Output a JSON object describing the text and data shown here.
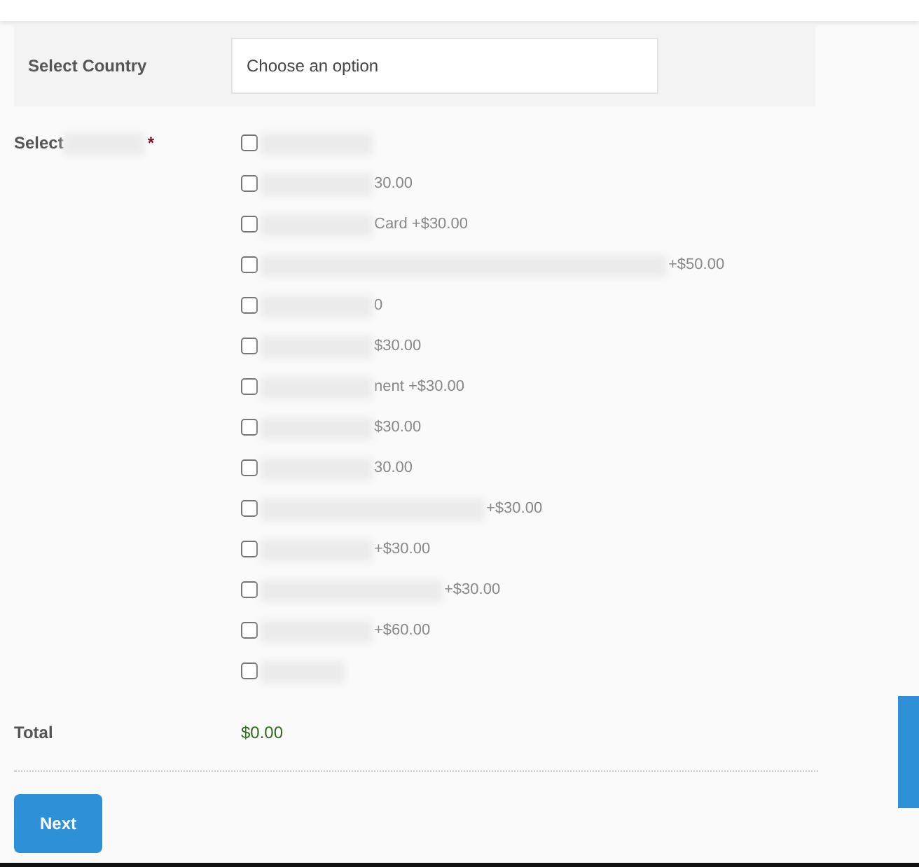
{
  "country": {
    "label": "Select Country",
    "placeholder": "Choose an option"
  },
  "documents": {
    "label": "Select",
    "required_mark": "*",
    "options": [
      {
        "checked": false
      },
      {
        "text": "30.00",
        "checked": false
      },
      {
        "text": "Card +$30.00",
        "checked": false
      },
      {
        "text": "+$50.00",
        "checked": false
      },
      {
        "text": "0",
        "checked": false
      },
      {
        "text": "$30.00",
        "checked": false
      },
      {
        "text": "nent +$30.00",
        "checked": false
      },
      {
        "text": "$30.00",
        "checked": false
      },
      {
        "text": "30.00",
        "checked": false
      },
      {
        "text": "+$30.00",
        "checked": false
      },
      {
        "text": "+$30.00",
        "checked": false
      },
      {
        "text": "+$30.00",
        "checked": false
      },
      {
        "text": "+$60.00",
        "checked": false
      },
      {
        "checked": false
      }
    ]
  },
  "total": {
    "label": "Total",
    "value": "$0.00"
  },
  "buttons": [
    "Next"
  ]
}
